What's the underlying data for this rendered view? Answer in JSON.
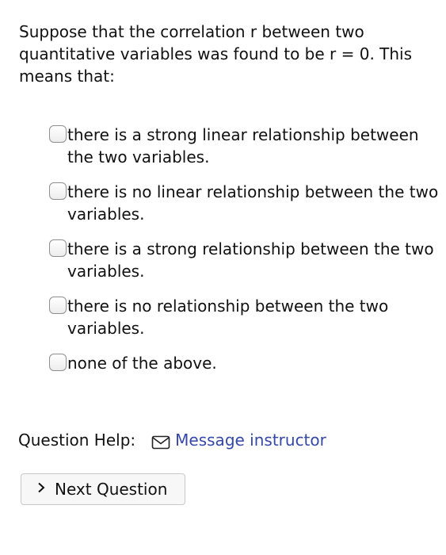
{
  "question": {
    "text": "Suppose that the correlation r between two quantitative variables was found to be r = 0. This means that:"
  },
  "options": [
    {
      "label": "there is a strong linear relationship between the two variables.",
      "checked": false
    },
    {
      "label": "there is no linear relationship between the two variables.",
      "checked": false
    },
    {
      "label": "there is a strong relationship between the two variables.",
      "checked": false
    },
    {
      "label": "there is no relationship between the two variables.",
      "checked": false
    },
    {
      "label": "none of the above.",
      "checked": false
    }
  ],
  "help": {
    "label": "Question Help:",
    "link_text": "Message instructor",
    "link_icon": "envelope-icon",
    "link_color": "#3547a8"
  },
  "next_button": {
    "label": "Next Question",
    "icon": "chevron-right-icon"
  }
}
